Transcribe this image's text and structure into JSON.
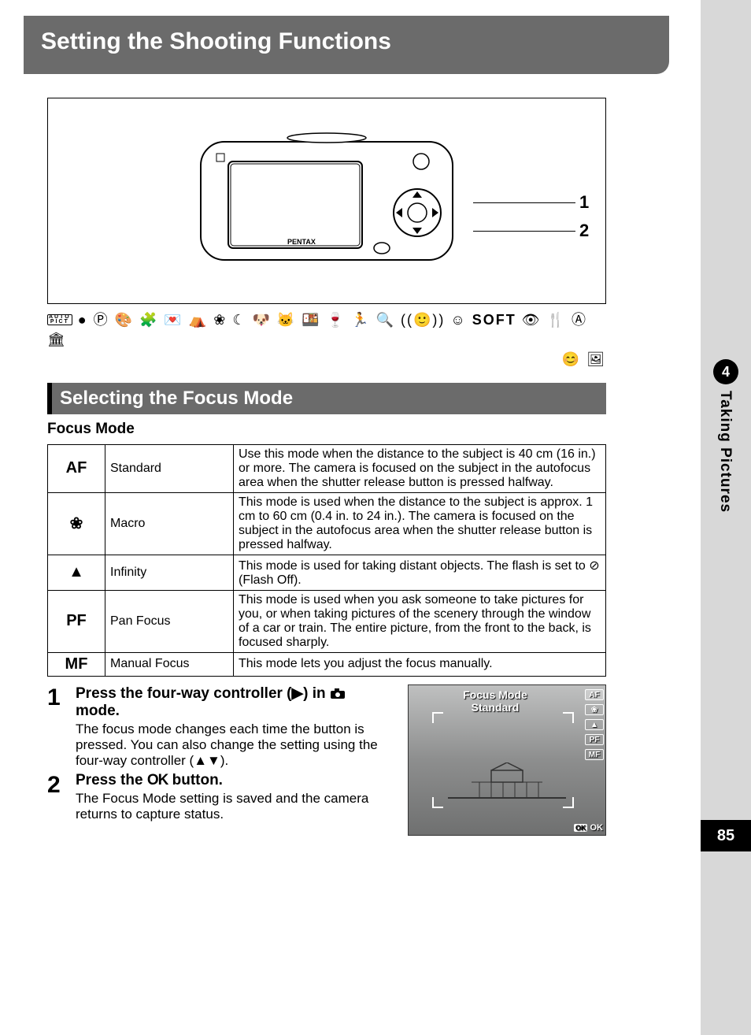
{
  "sidebar": {
    "chapter_number": "4",
    "chapter_title": "Taking Pictures"
  },
  "page_number": "85",
  "chapter_heading": "Setting the Shooting Functions",
  "camera_brand": "PENTAX",
  "callouts": {
    "c1": "1",
    "c2": "2"
  },
  "mode_icons": "● Ⓟ 🎨 🧩 💌 ⛺ ❀ ☾ 🐶 🐱 🍱 🍷 🏃 🔍 ((🙂)) ☺",
  "mode_text_soft": "SOFT",
  "mode_icons_tail": "👁 🍴 Ⓐ 🏛",
  "mode_icons_line2": "😊 🖼",
  "section_title": "Selecting the Focus Mode",
  "table_title": "Focus Mode",
  "focus_table": [
    {
      "sym": "AF",
      "name": "Standard",
      "desc": "Use this mode when the distance to the subject is 40 cm (16 in.) or more. The camera is focused on the subject in the autofocus area when the shutter release button is pressed halfway."
    },
    {
      "sym": "❀",
      "name": "Macro",
      "desc": "This mode is used when the distance to the subject is approx. 1 cm to 60 cm (0.4 in. to 24 in.). The camera is focused on the subject in the autofocus area when the shutter release button is pressed halfway."
    },
    {
      "sym": "▲",
      "name": "Infinity",
      "desc": "This mode is used for taking distant objects. The flash is set to ⊘ (Flash Off)."
    },
    {
      "sym": "PF",
      "name": "Pan Focus",
      "desc": "This mode is used when you ask someone to take pictures for you, or when taking pictures of the scenery through the window of a car or train. The entire picture, from the front to the back, is focused sharply."
    },
    {
      "sym": "MF",
      "name": "Manual Focus",
      "desc": "This mode lets you adjust the focus manually."
    }
  ],
  "steps": [
    {
      "num": "1",
      "title_pre": "Press the four-way controller (▶) in ",
      "title_post": " mode.",
      "body": "The focus mode changes each time the button is pressed. You can also change the setting using the four-way controller (▲▼)."
    },
    {
      "num": "2",
      "title_pre": "Press the ",
      "title_mid": "OK",
      "title_post": " button.",
      "body": "The Focus Mode setting is saved and the camera returns to capture status."
    }
  ],
  "lcd": {
    "title_l1": "Focus Mode",
    "title_l2": "Standard",
    "side": [
      "AF",
      "❀",
      "▲",
      "PF",
      "MF"
    ],
    "ok_label": "OK",
    "ok_btn": "OK"
  }
}
